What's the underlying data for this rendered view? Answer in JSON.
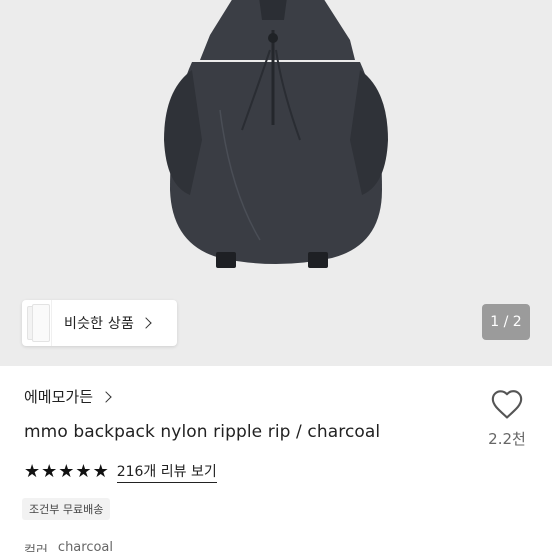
{
  "similar_products": {
    "label": "비슷한 상품"
  },
  "pager": {
    "text": "1 / 2"
  },
  "store": {
    "name": "에메모가든"
  },
  "product": {
    "name": "mmo backpack nylon ripple rip / charcoal"
  },
  "rating": {
    "stars": 5,
    "review_text": "216개 리뷰 보기"
  },
  "shipping": {
    "badge": "조건부 무료배송"
  },
  "option": {
    "label": "컬러",
    "value": "charcoal"
  },
  "like": {
    "count": "2.2천",
    "icon": "heart-icon"
  },
  "colors": {
    "backpack": "#3a3d44",
    "hero_bg": "#ececec"
  }
}
